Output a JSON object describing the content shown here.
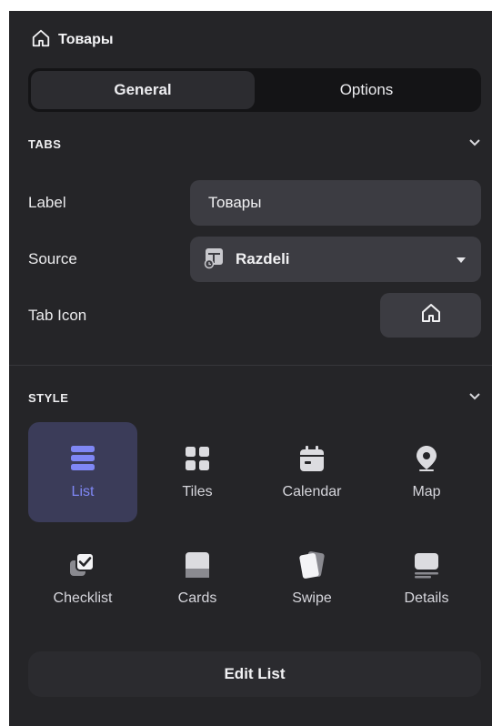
{
  "header": {
    "title": "Товары",
    "icon": "home-icon"
  },
  "segmented": {
    "general_label": "General",
    "options_label": "Options",
    "active": "General"
  },
  "tabs_section": {
    "title": "TABS",
    "label_field": {
      "label": "Label",
      "value": "Товары"
    },
    "source_field": {
      "label": "Source",
      "value": "Razdeli",
      "icon": "table-icon"
    },
    "tab_icon_field": {
      "label": "Tab Icon",
      "value_icon": "home-icon"
    }
  },
  "style_section": {
    "title": "STYLE",
    "selected": "List",
    "options": [
      {
        "label": "List",
        "icon": "list-icon"
      },
      {
        "label": "Tiles",
        "icon": "tiles-icon"
      },
      {
        "label": "Calendar",
        "icon": "calendar-icon"
      },
      {
        "label": "Map",
        "icon": "map-pin-icon"
      },
      {
        "label": "Checklist",
        "icon": "checklist-icon"
      },
      {
        "label": "Cards",
        "icon": "cards-icon"
      },
      {
        "label": "Swipe",
        "icon": "swipe-icon"
      },
      {
        "label": "Details",
        "icon": "details-icon"
      }
    ]
  },
  "edit_button": {
    "label": "Edit List"
  },
  "colors": {
    "panel": "#252528",
    "field": "#3c3c42",
    "selected_tile": "#3b3c59",
    "accent": "#7f87f5"
  }
}
